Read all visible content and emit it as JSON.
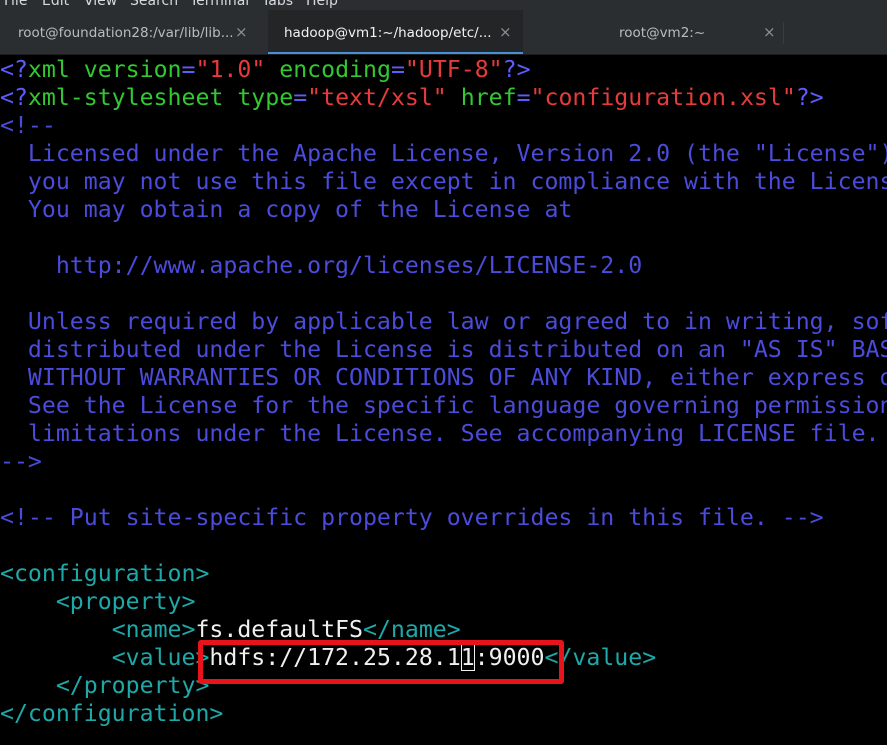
{
  "menu": {
    "items": [
      "File",
      "Edit",
      "View",
      "Search",
      "Terminal",
      "Tabs",
      "Help"
    ]
  },
  "tabs": [
    {
      "label": "root@foundation28:/var/lib/lib...",
      "active": false
    },
    {
      "label": "hadoop@vm1:~/hadoop/etc/...",
      "active": true
    },
    {
      "label": "root@vm2:~",
      "active": false
    }
  ],
  "tab_close_glyph": "×",
  "editor": {
    "xml_decl": {
      "open": "<?",
      "name": "xml",
      "attr1": "version",
      "eq": "=",
      "val1": "\"1.0\"",
      "attr2": "encoding",
      "val2": "\"UTF-8\"",
      "close": "?>"
    },
    "stylesheet_decl": {
      "open": "<?",
      "name": "xml-stylesheet",
      "attr1": "type",
      "eq": "=",
      "val1": "\"text/xsl\"",
      "attr2": "href",
      "val2": "\"configuration.xsl\"",
      "close": "?>"
    },
    "comment_open": "<!--",
    "license_lines": [
      "  Licensed under the Apache License, Version 2.0 (the \"License\");",
      "  you may not use this file except in compliance with the License.",
      "  You may obtain a copy of the License at",
      "",
      "    http://www.apache.org/licenses/LICENSE-2.0",
      "",
      "  Unless required by applicable law or agreed to in writing, software",
      "  distributed under the License is distributed on an \"AS IS\" BASIS,",
      "  WITHOUT WARRANTIES OR CONDITIONS OF ANY KIND, either express or implied.",
      "  See the License for the specific language governing permissions and",
      "  limitations under the License. See accompanying LICENSE file."
    ],
    "comment_close": "-->",
    "site_comment": "<!-- Put site-specific property overrides in this file. -->",
    "config_open": "<configuration>",
    "property_open": "<property>",
    "name_open": "<name>",
    "name_value": "fs.defaultFS",
    "name_close": "</name>",
    "value_open": "<value>",
    "value_text_before_cursor": "hdfs://172.25.28.1",
    "value_cursor_char": "1",
    "value_text_after_cursor": ":9000",
    "value_close": "</value>",
    "property_close": "</property>",
    "config_close": "</configuration>"
  },
  "colors": {
    "tag": "#1fa8a8",
    "comment": "#4b4bdc",
    "attribute": "#32c832",
    "string": "#e83a3a",
    "punctuation": "#5c5cff",
    "text": "#f0f0f0",
    "highlight_border": "#e8141c",
    "active_tab_underline": "#4a90d9"
  }
}
